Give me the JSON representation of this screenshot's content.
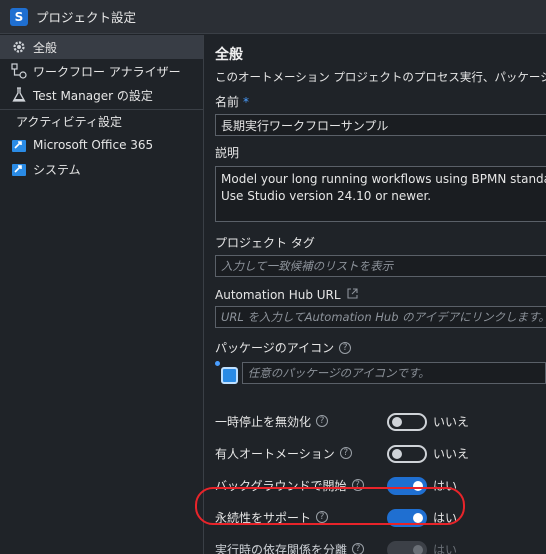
{
  "window": {
    "title": "プロジェクト設定",
    "app_icon": "S"
  },
  "sidebar": {
    "items": [
      {
        "label": "全般",
        "icon": "gear-icon",
        "active": true
      },
      {
        "label": "ワークフロー アナライザー",
        "icon": "workflow-analyzer-icon"
      },
      {
        "label": "Test Manager の設定",
        "icon": "flask-icon"
      }
    ],
    "section_label": "アクティビティ設定",
    "activity_items": [
      {
        "label": "Microsoft Office 365",
        "icon": "activity-package-icon"
      },
      {
        "label": "システム",
        "icon": "activity-package-icon"
      }
    ]
  },
  "main": {
    "heading": "全般",
    "description": "このオートメーション プロジェクトのプロセス実行、パッケージ、プロジェクトの",
    "name_label": "名前",
    "name_required": "*",
    "name_value": "長期実行ワークフローサンプル",
    "desc_label": "説明",
    "desc_line1": "Model your long running workflows using BPMN standard",
    "desc_line2": "Use Studio version 24.10 or newer.",
    "tags_label": "プロジェクト タグ",
    "tags_placeholder": "入力して一致候補のリストを表示",
    "hub_label": "Automation Hub URL",
    "hub_placeholder": "URL を入力してAutomation Hub のアイデアにリンクします。",
    "pkg_icon_label": "パッケージのアイコン",
    "pkg_icon_placeholder": "任意のパッケージのアイコンです。",
    "help_glyph": "?",
    "toggles": [
      {
        "label": "一時停止を無効化",
        "value": "いいえ",
        "state": "off"
      },
      {
        "label": "有人オートメーション",
        "value": "いいえ",
        "state": "off"
      },
      {
        "label": "バックグラウンドで開始",
        "value": "はい",
        "state": "on"
      },
      {
        "label": "永続性をサポート",
        "value": "はい",
        "state": "on"
      },
      {
        "label": "実行時の依存関係を分離",
        "value": "はい",
        "state": "disabled"
      }
    ]
  },
  "colors": {
    "accent": "#1f6fd1",
    "highlight": "#e8242a",
    "background": "#1f2328"
  }
}
